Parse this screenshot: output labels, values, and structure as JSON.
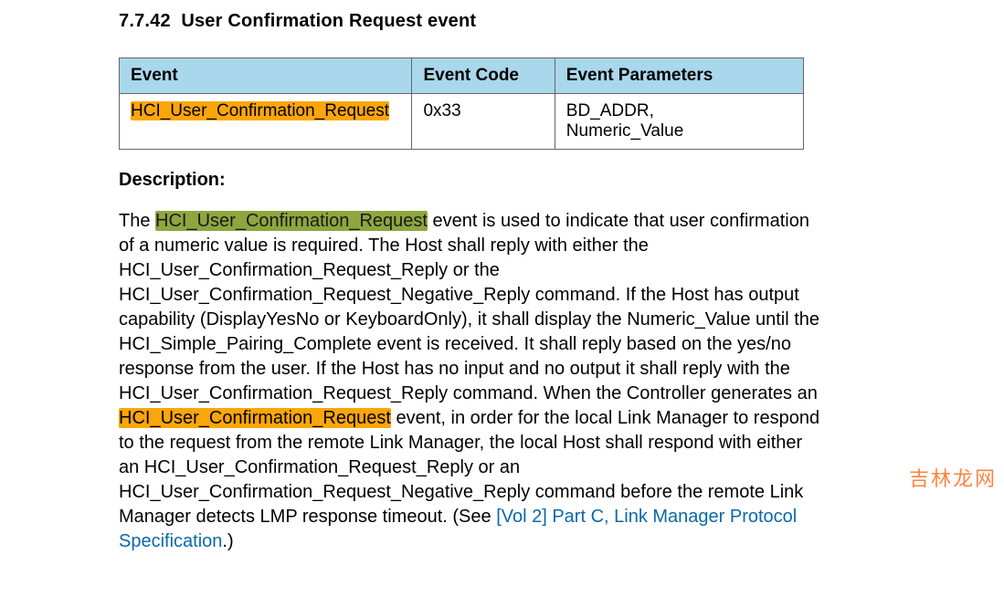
{
  "heading": {
    "number": "7.7.42",
    "title": "User Confirmation Request event"
  },
  "table": {
    "headers": {
      "event": "Event",
      "code": "Event Code",
      "params": "Event Parameters"
    },
    "row": {
      "event": "HCI_User_Confirmation_Request",
      "code": "0x33",
      "param1": "BD_ADDR,",
      "param2": "Numeric_Value"
    }
  },
  "description": {
    "label": "Description:",
    "t0": "The ",
    "hl_green": "HCI_User_Confirmation_Request",
    "t1": " event is used to indicate that user confirmation of a numeric value is required. The Host shall reply with either the HCI_User_Confirmation_Request_Reply or the HCI_User_Confirmation_Request_Negative_Reply command. If the Host has output capability (DisplayYesNo or KeyboardOnly), it shall display the Numeric_Value until the HCI_Simple_Pairing_Complete event is received. It shall reply based on the yes/no response from the user. If the Host has no input and no output it shall reply with the HCI_User_Confirmation_Request_Reply command. When the Controller generates an ",
    "hl_orange": "HCI_User_Confirmation_Request",
    "t2": " event, in order for the local Link Manager to respond to the request from the remote Link Manager, the local Host shall respond with either an HCI_User_Confirmation_Request_Reply or an HCI_User_Confirmation_Request_Negative_Reply command before the remote Link Manager detects LMP response timeout. (See ",
    "link": "[Vol 2] Part C, Link Manager Protocol Specification",
    "t3": ".)"
  },
  "watermark": "吉林龙网"
}
